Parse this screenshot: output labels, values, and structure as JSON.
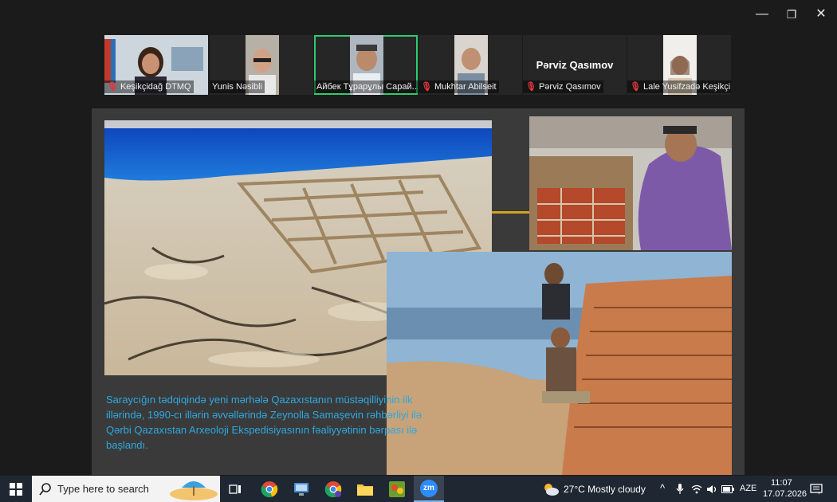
{
  "window": {
    "controls": [
      "minimize",
      "restore",
      "close"
    ],
    "minimize_glyph": "—",
    "restore_glyph": "❐",
    "close_glyph": "✕"
  },
  "gallery": {
    "participants": [
      {
        "name": "Keşikçidağ DTMQ",
        "muted": true,
        "active": false,
        "video": true
      },
      {
        "name": "Yunis Nəsibli",
        "muted": false,
        "active": false,
        "video": true
      },
      {
        "name": "Айбек Тұрарұлы Сарай...",
        "muted": false,
        "active": true,
        "video": true
      },
      {
        "name": "Mukhtar Abilseit",
        "muted": true,
        "active": false,
        "video": true
      },
      {
        "name": "Pərviz Qasımov",
        "muted": true,
        "active": false,
        "video": false,
        "display_name": "Pərviz Qasımov"
      },
      {
        "name": "Lale Yusifzadə Keşikçi...",
        "muted": true,
        "active": false,
        "video": true
      }
    ]
  },
  "slide": {
    "caption": "Saraycığın tədqiqində yeni mərhələ Qazaxıstanın müstəqilliyinin ilk illərində, 1990-cı illərin əvvəllərində Zeynolla Samaşevin rəhbərliyi ilə Qərbi Qazaxıstan Arxeoloji Ekspedisiyasının fəaliyyətinin bərpası ilə başlandı.",
    "caption_color": "#2ea8e0"
  },
  "taskbar": {
    "search_placeholder": "Type here to search",
    "apps": [
      "task-view",
      "chrome",
      "network-app",
      "chrome-profile",
      "file-explorer",
      "game-app",
      "zoom"
    ],
    "zoom_label": "zm",
    "weather": "27°C  Mostly cloudy",
    "language": "AZE",
    "time": "11:07",
    "date": "17.07.2026"
  },
  "colors": {
    "background": "#1b1b1b",
    "taskbar": "#1f2732",
    "active_speaker": "#2ecc71",
    "muted_icon": "#e0353b"
  }
}
